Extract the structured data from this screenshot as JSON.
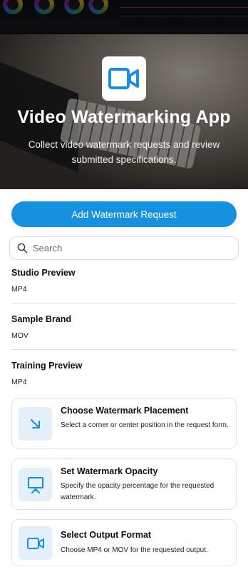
{
  "hero": {
    "title": "Video Watermarking App",
    "subtitle": "Collect video watermark requests and review submitted specifications.",
    "logo_icon": "video-camera-icon"
  },
  "colors": {
    "accent": "#1591e0",
    "icon_tile_bg": "#e3f0fa",
    "divider": "#e2e2e2"
  },
  "actions": {
    "add_label": "Add Watermark Request"
  },
  "search": {
    "placeholder": "Search",
    "value": "",
    "icon": "search-icon"
  },
  "requests": [
    {
      "name": "Studio Preview",
      "format": "MP4"
    },
    {
      "name": "Sample Brand",
      "format": "MOV"
    },
    {
      "name": "Training Preview",
      "format": "MP4"
    }
  ],
  "features": [
    {
      "icon": "arrow-down-right-icon",
      "title": "Choose Watermark Placement",
      "description": "Select a corner or center position in the request form."
    },
    {
      "icon": "presentation-board-icon",
      "title": "Set Watermark Opacity",
      "description": "Specify the opacity percentage for the requested watermark."
    },
    {
      "icon": "video-camera-icon",
      "title": "Select Output Format",
      "description": "Choose MP4 or MOV for the requested output."
    }
  ]
}
